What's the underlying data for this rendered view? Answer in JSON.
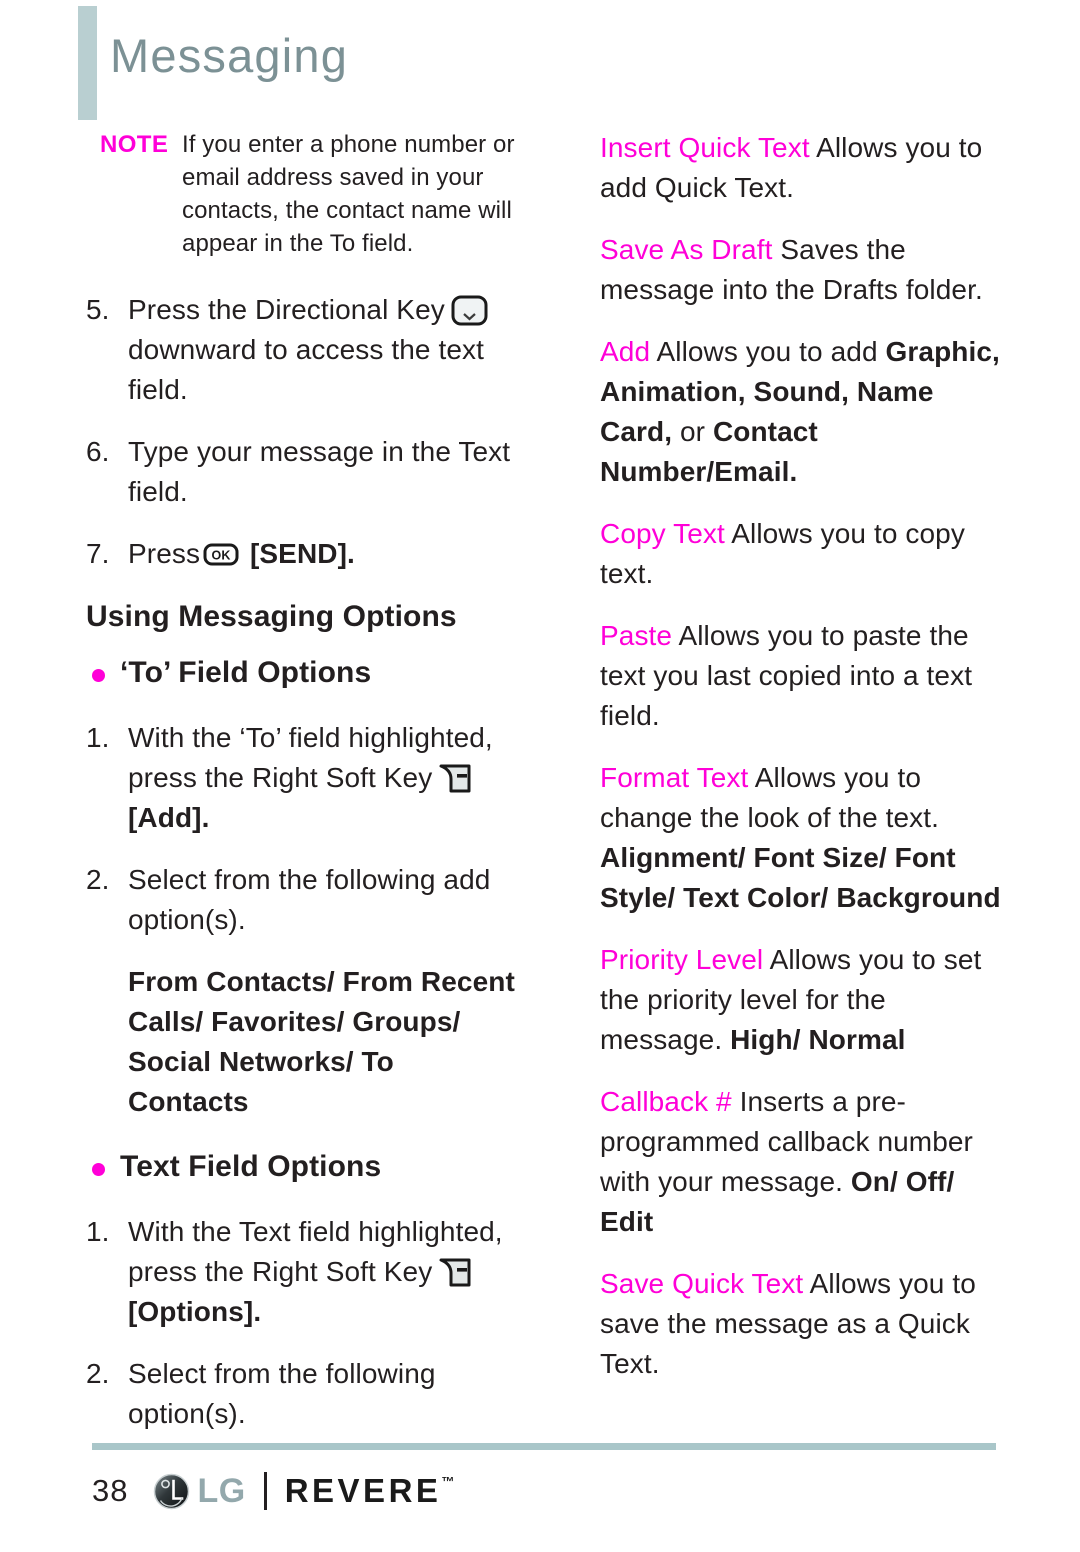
{
  "header": {
    "title": "Messaging",
    "accent_bar_color": "#b9cfd1",
    "title_color": "#7c9195"
  },
  "colors": {
    "magenta": "#ff00d8",
    "header_gray": "#7c9195",
    "rule": "#a9c6c9",
    "body_text": "#231f20"
  },
  "left_column": {
    "note": {
      "label": "NOTE",
      "text": "If you enter a phone number or email address saved in your contacts, the contact name will appear in the To field."
    },
    "steps": [
      {
        "num": "5.",
        "text_before": "Press the Directional Key",
        "icon": "directional-key-icon",
        "text_after": "downward to access the text field."
      },
      {
        "num": "6.",
        "text_before": "Type your message in the Text field.",
        "icon": "",
        "text_after": ""
      },
      {
        "num": "7.",
        "text_before": "Press",
        "icon": "ok-key-icon",
        "text_after": "[SEND]."
      }
    ],
    "section_heading": "Using Messaging Options",
    "to_field": {
      "bullet_label": "‘To’ Field Options",
      "step1_num": "1.",
      "step1_before": "With the ‘To’ field highlighted, press the Right Soft Key",
      "step1_icon": "right-soft-key-icon",
      "step1_after": "[Add].",
      "step2_num": "2.",
      "step2_text": "Select from the following add option(s).",
      "options": "From Contacts/ From Recent Calls/ Favorites/ Groups/ Social Networks/ To Contacts"
    },
    "text_field": {
      "bullet_label": "Text Field Options",
      "step1_num": "1.",
      "step1_before": "With the Text field highlighted, press the Right Soft Key",
      "step1_icon": "right-soft-key-icon",
      "step1_after": "[Options].",
      "step2_num": "2.",
      "step2_text": "Select from the following option(s)."
    }
  },
  "right_column": {
    "options": [
      {
        "term": "Insert Quick Text",
        "desc": "Allows you to add Quick Text.",
        "bold_tail": ""
      },
      {
        "term": "Save As Draft",
        "desc": "Saves the message into the Drafts folder.",
        "bold_tail": ""
      },
      {
        "term": "Add",
        "desc": "Allows you to add ",
        "bold_inline": "Graphic, Animation, Sound, Name Card,",
        "desc_mid": " or ",
        "bold_inline2": "Contact Number/Email.",
        "bold_tail": ""
      },
      {
        "term": "Copy Text",
        "desc": "Allows you to copy text.",
        "bold_tail": ""
      },
      {
        "term": "Paste",
        "desc": "Allows you to paste the text you last copied into a text field.",
        "bold_tail": ""
      },
      {
        "term": "Format Text",
        "desc": "Allows you to change the look of the text.",
        "bold_tail": "Alignment/ Font Size/ Font Style/ Text Color/ Background"
      },
      {
        "term": "Priority Level",
        "desc": "Allows you to set the priority level for the message.",
        "bold_tail": "High/ Normal"
      },
      {
        "term": "Callback #",
        "desc": "Inserts a pre-programmed callback number with your message.",
        "bold_tail": "On/ Off/ Edit"
      },
      {
        "term": "Save Quick Text",
        "desc": "Allows you to save the message as a Quick Text.",
        "bold_tail": ""
      }
    ]
  },
  "footer": {
    "page_number": "38",
    "brand": "LG",
    "model": "REVERE",
    "trademark": "™"
  }
}
